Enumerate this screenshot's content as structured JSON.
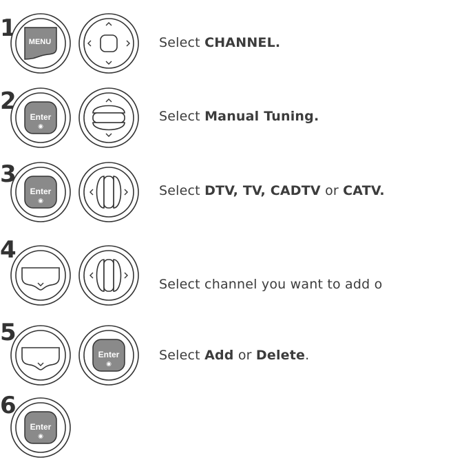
{
  "buttons": {
    "menu_label": "MENU",
    "enter_label": "Enter",
    "enter_dot": "◉"
  },
  "steps": [
    {
      "number": "1",
      "instruction_parts": [
        "Select ",
        "CHANNEL."
      ]
    },
    {
      "number": "2",
      "instruction_parts": [
        "Select ",
        "Manual Tuning."
      ]
    },
    {
      "number": "3",
      "instruction_parts": [
        "Select ",
        "DTV, TV, CADTV",
        " or ",
        "CATV."
      ]
    },
    {
      "number": "4",
      "instruction_parts": [
        "Select channel you want to add o"
      ]
    },
    {
      "number": "5",
      "instruction_parts": [
        "Select ",
        "Add",
        " or ",
        "Delete",
        "."
      ]
    },
    {
      "number": "6",
      "instruction_parts": []
    }
  ]
}
